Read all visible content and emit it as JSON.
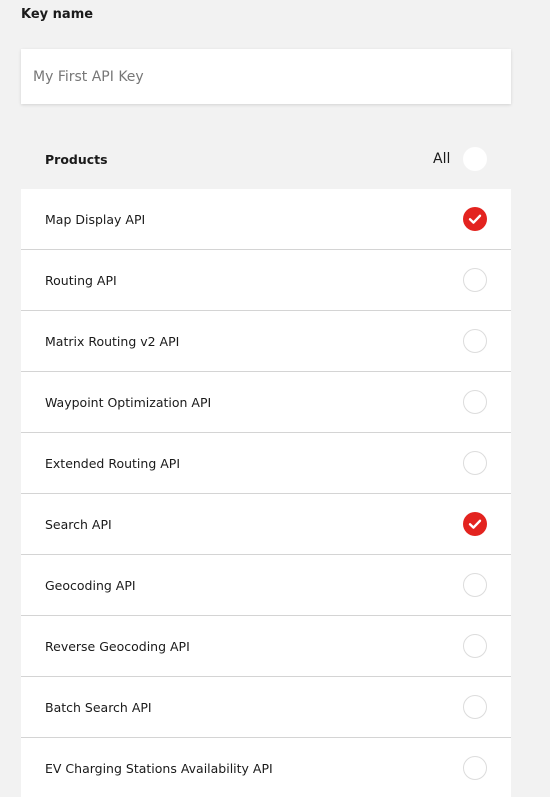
{
  "key_name": {
    "label": "Key name",
    "placeholder": "My First API Key",
    "value": ""
  },
  "products": {
    "title": "Products",
    "all_label": "All",
    "all_selected": false,
    "items": [
      {
        "label": "Map Display API",
        "checked": true
      },
      {
        "label": "Routing API",
        "checked": false
      },
      {
        "label": "Matrix Routing v2 API",
        "checked": false
      },
      {
        "label": "Waypoint Optimization API",
        "checked": false
      },
      {
        "label": "Extended Routing API",
        "checked": false
      },
      {
        "label": "Search API",
        "checked": true
      },
      {
        "label": "Geocoding API",
        "checked": false
      },
      {
        "label": "Reverse Geocoding API",
        "checked": false
      },
      {
        "label": "Batch Search API",
        "checked": false
      },
      {
        "label": "EV Charging Stations Availability API",
        "checked": false
      }
    ]
  },
  "colors": {
    "accent": "#e3231f",
    "background": "#f2f2f2"
  },
  "icons": {
    "checked": "checkmark-icon",
    "unchecked": "empty-circle-icon"
  }
}
